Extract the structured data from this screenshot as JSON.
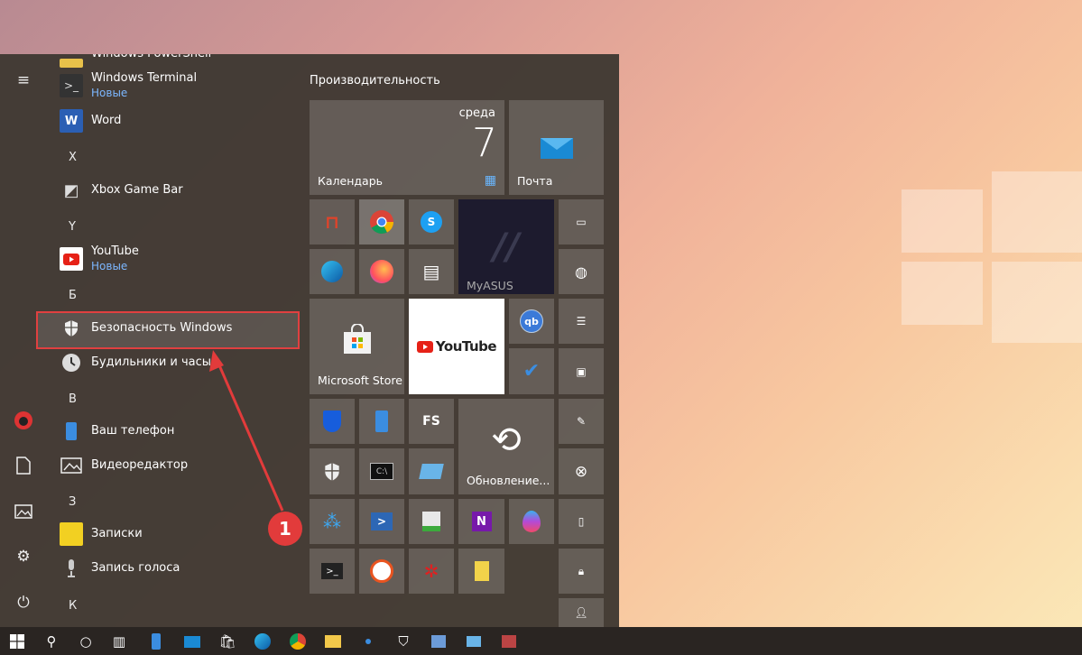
{
  "applist": {
    "partial_top": "Windows PowerShell",
    "items": [
      {
        "label": "Windows Terminal",
        "sub": "Новые",
        "icon": "terminal-icon"
      },
      {
        "label": "Word",
        "sub": "",
        "icon": "word-icon"
      },
      {
        "letter": "X"
      },
      {
        "label": "Xbox Game Bar",
        "sub": "",
        "icon": "xbox-game-bar-icon"
      },
      {
        "letter": "Y"
      },
      {
        "label": "YouTube",
        "sub": "Новые",
        "icon": "youtube-icon"
      },
      {
        "letter": "Б"
      },
      {
        "label": "Безопасность Windows",
        "sub": "",
        "icon": "shield-icon"
      },
      {
        "label": "Будильники и часы",
        "sub": "",
        "icon": "clock-icon"
      },
      {
        "letter": "В"
      },
      {
        "label": "Ваш телефон",
        "sub": "",
        "icon": "phone-icon"
      },
      {
        "label": "Видеоредактор",
        "sub": "",
        "icon": "video-editor-icon"
      },
      {
        "letter": "З"
      },
      {
        "label": "Записки",
        "sub": "",
        "icon": "sticky-notes-icon"
      },
      {
        "label": "Запись голоса",
        "sub": "",
        "icon": "microphone-icon"
      },
      {
        "letter": "К"
      }
    ]
  },
  "tiles": {
    "group_title": "Производительность",
    "calendar": {
      "day": "среда",
      "date": "7",
      "label": "Календарь"
    },
    "mail": {
      "label": "Почта"
    },
    "myasus": {
      "label": "MyASUS"
    },
    "store": {
      "label": "Microsoft Store"
    },
    "youtube": {
      "label": "YouTube"
    },
    "update": {
      "label": "Обновление..."
    },
    "fs_text": "FS"
  },
  "annotation": {
    "number": "1"
  },
  "colors": {
    "highlight": "#e04040",
    "accent": "#3b8de0"
  }
}
